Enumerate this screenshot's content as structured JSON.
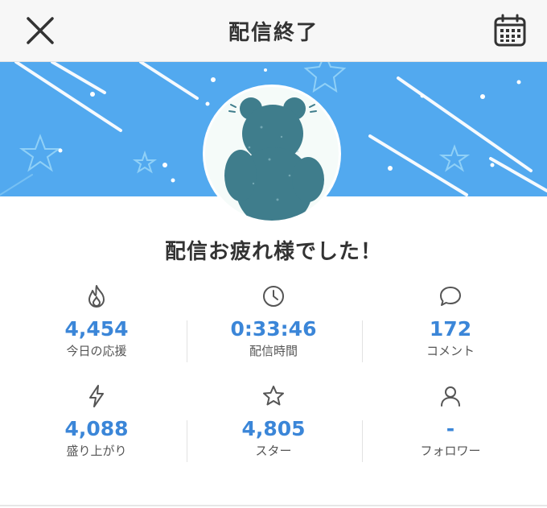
{
  "header": {
    "title": "配信終了",
    "close_icon": "close-icon",
    "calendar_icon": "calendar-icon"
  },
  "banner": {
    "color": "#52a9ef"
  },
  "message": "配信お疲れ様でした！",
  "stats": [
    {
      "icon": "flame-icon",
      "value": "4,454",
      "label": "今日の応援"
    },
    {
      "icon": "clock-icon",
      "value": "0:33:46",
      "label": "配信時間"
    },
    {
      "icon": "speech-bubble-icon",
      "value": "172",
      "label": "コメント"
    },
    {
      "icon": "lightning-icon",
      "value": "4,088",
      "label": "盛り上がり"
    },
    {
      "icon": "star-icon",
      "value": "4,805",
      "label": "スター"
    },
    {
      "icon": "user-icon",
      "value": "-",
      "label": "フォロワー"
    }
  ],
  "colors": {
    "accent": "#3b86d8",
    "avatar_silhouette": "#3f7d8c"
  }
}
